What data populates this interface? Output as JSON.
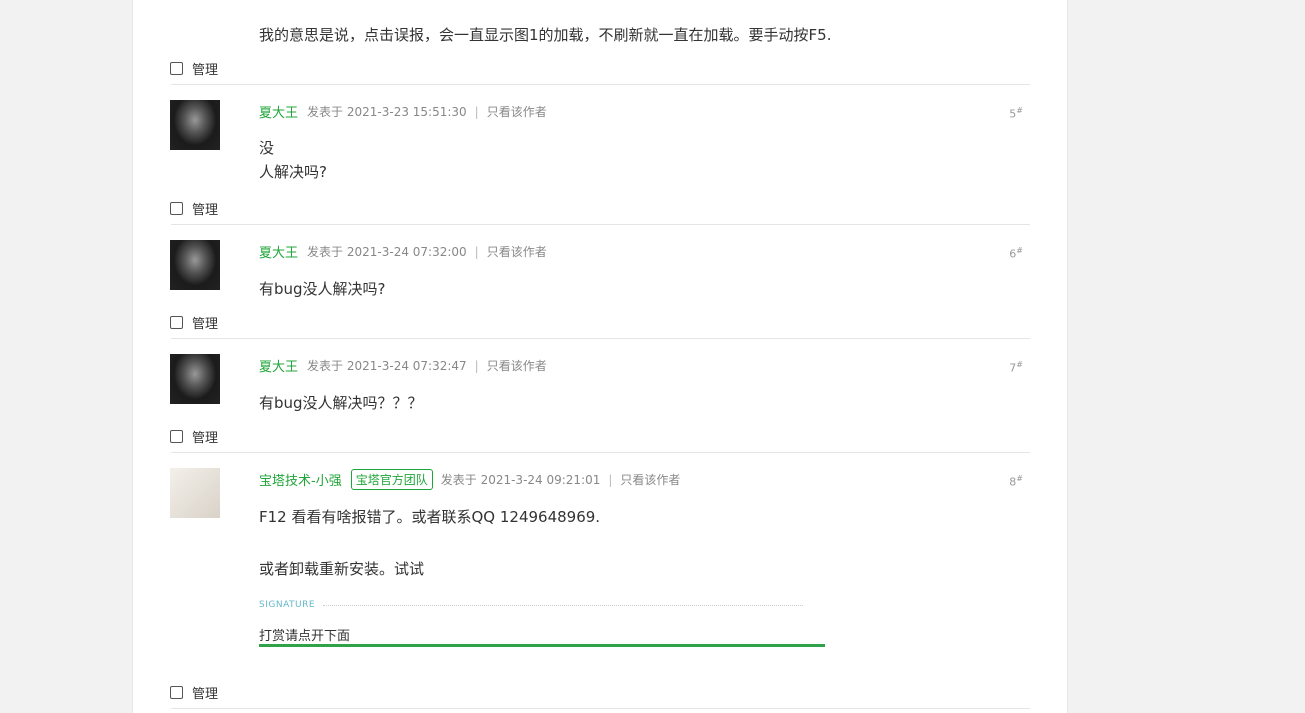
{
  "first_post_text": "我的意思是说，点击误报，会一直显示图1的加载，不刷新就一直在加载。要手动按F5.",
  "manage_label": "管理",
  "meta": {
    "posted_prefix": "发表于",
    "only_author": "只看该作者",
    "separator": "|"
  },
  "posts": [
    {
      "author": "夏大王",
      "time": "2021-3-23 15:51:30",
      "floor": "5",
      "lines": [
        "没",
        "人解决吗?"
      ]
    },
    {
      "author": "夏大王",
      "time": "2021-3-24 07:32:00",
      "floor": "6",
      "lines": [
        "有bug没人解决吗?"
      ]
    },
    {
      "author": "夏大王",
      "time": "2021-3-24 07:32:47",
      "floor": "7",
      "lines": [
        "有bug没人解决吗？？？"
      ]
    },
    {
      "author": "宝塔技术-小强",
      "badge": "宝塔官方团队",
      "time": "2021-3-24 09:21:01",
      "floor": "8",
      "lines": [
        "F12 看看有啥报错了。或者联系QQ 1249648969.",
        "或者卸载重新安装。试试"
      ],
      "signature_label": "SIGNATURE",
      "signature_text": "打赏请点开下面"
    }
  ],
  "floor_mark": "#",
  "colors": {
    "accent_green": "#20a53a",
    "signature_bar": "#2fa24a",
    "page_bg": "#f2f2f2"
  }
}
